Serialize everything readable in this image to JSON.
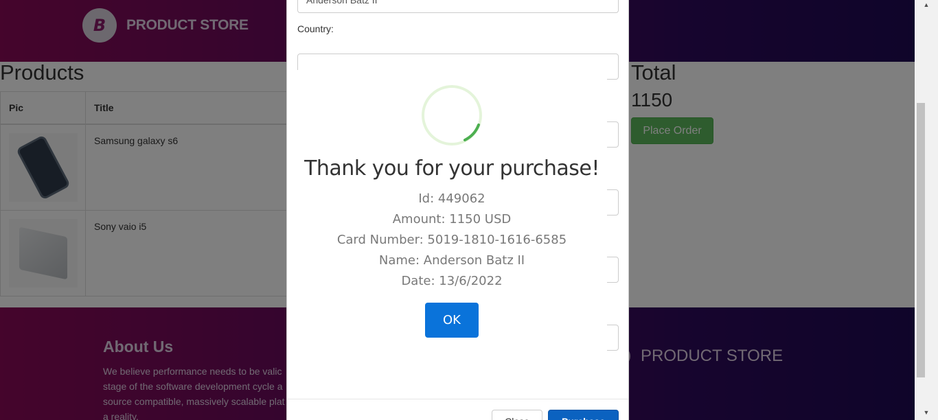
{
  "navbar": {
    "brand_logo_letter": "B",
    "brand_name": "PRODUCT STORE"
  },
  "cart": {
    "products_heading": "Products",
    "columns": [
      "Pic",
      "Title"
    ],
    "rows": [
      {
        "title": "Samsung galaxy s6"
      },
      {
        "title": "Sony vaio i5"
      }
    ],
    "total_heading": "Total",
    "total_value": "1150",
    "place_order_label": "Place Order"
  },
  "footer": {
    "about_title": "About Us",
    "about_text": "We believe performance needs to be valic\nstage of the software development cycle a\nsource compatible, massively scalable plat\na reality.",
    "brand_name": "PRODUCT STORE"
  },
  "order_modal": {
    "name_value": "Anderson Batz II",
    "country_label": "Country:",
    "close_label": "Close",
    "purchase_label": "Purchase"
  },
  "confirmation": {
    "title": "Thank you for your purchase!",
    "id_line": "Id: 449062",
    "amount_line": "Amount: 1150 USD",
    "card_line": "Card Number: 5019-1810-1616-6585",
    "name_line": "Name: Anderson Batz II",
    "date_line": "Date: 13/6/2022",
    "ok_label": "OK",
    "spinner_color": "#4caf50"
  },
  "colors": {
    "brand_gradient_start": "#8a0a58",
    "brand_gradient_end": "#1f0b55",
    "place_order": "#5cb85c",
    "purchase": "#0b62c0",
    "ok_button": "#0a73da"
  }
}
